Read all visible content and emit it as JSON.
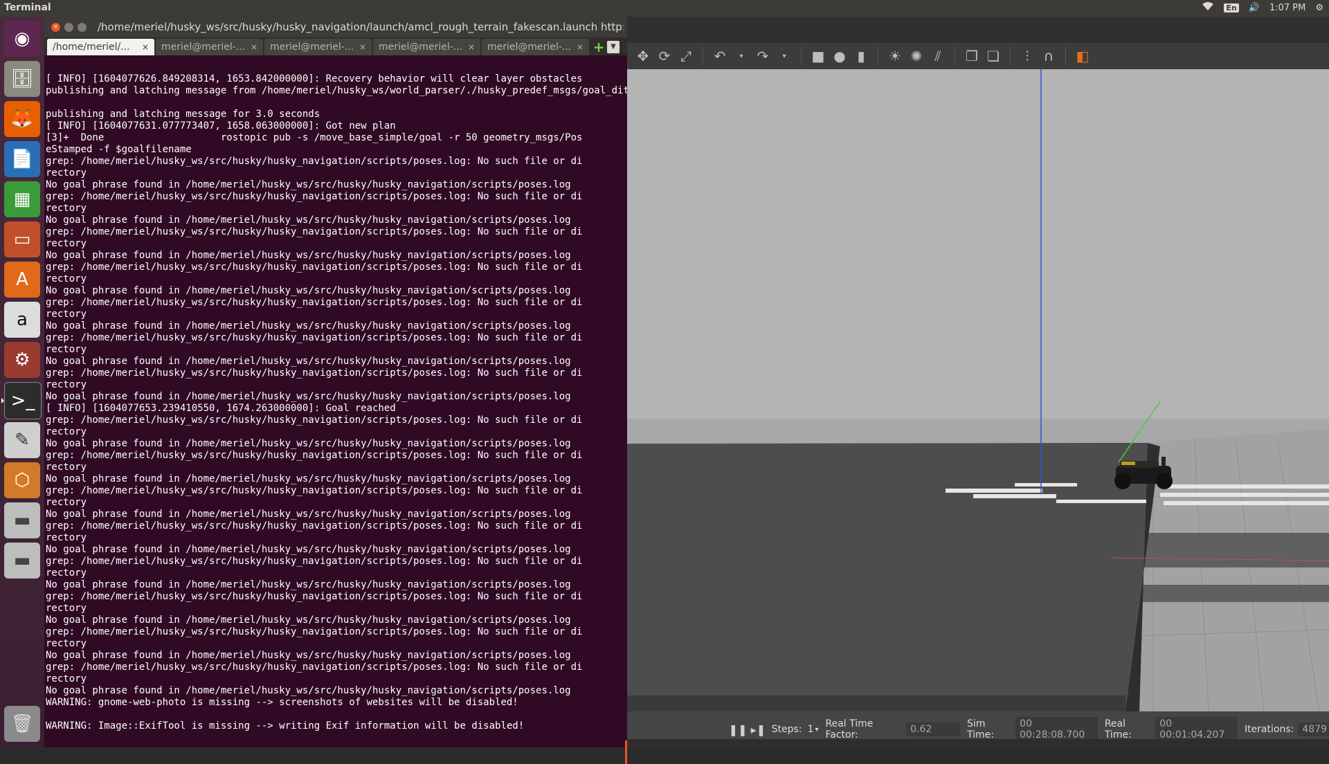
{
  "top_panel": {
    "app_title": "Terminal",
    "keyboard": "En",
    "time": "1:07 PM"
  },
  "launcher": {
    "items": [
      "ubuntu-dash",
      "files",
      "firefox",
      "writer",
      "calc",
      "impress",
      "software-center",
      "amazon",
      "system-settings",
      "terminal",
      "text-editor",
      "virtualbox",
      "drive-1",
      "drive-2",
      "trash"
    ]
  },
  "terminal": {
    "title": "/home/meriel/husky_ws/src/husky/husky_navigation/launch/amcl_rough_terrain_fakescan.launch http:/",
    "tabs": [
      {
        "label": "/home/meriel/..."
      },
      {
        "label": "meriel@meriel-..."
      },
      {
        "label": "meriel@meriel-..."
      },
      {
        "label": "meriel@meriel-..."
      },
      {
        "label": "meriel@meriel-..."
      }
    ],
    "lines": [
      "[ INFO] [1604077626.849208314, 1653.842000000]: Recovery behavior will clear layer obstacles",
      "publishing and latching message from /home/meriel/husky_ws/world_parser/./husky_predef_msgs/goal_ditch",
      "",
      "publishing and latching message for 3.0 seconds",
      "[ INFO] [1604077631.077773407, 1658.063000000]: Got new plan",
      "[3]+  Done                    rostopic pub -s /move_base_simple/goal -r 50 geometry_msgs/Pos",
      "eStamped -f $goalfilename",
      "grep: /home/meriel/husky_ws/src/husky/husky_navigation/scripts/poses.log: No such file or di",
      "rectory",
      "No goal phrase found in /home/meriel/husky_ws/src/husky/husky_navigation/scripts/poses.log",
      "grep: /home/meriel/husky_ws/src/husky/husky_navigation/scripts/poses.log: No such file or di",
      "rectory",
      "No goal phrase found in /home/meriel/husky_ws/src/husky/husky_navigation/scripts/poses.log",
      "grep: /home/meriel/husky_ws/src/husky/husky_navigation/scripts/poses.log: No such file or di",
      "rectory",
      "No goal phrase found in /home/meriel/husky_ws/src/husky/husky_navigation/scripts/poses.log",
      "grep: /home/meriel/husky_ws/src/husky/husky_navigation/scripts/poses.log: No such file or di",
      "rectory",
      "No goal phrase found in /home/meriel/husky_ws/src/husky/husky_navigation/scripts/poses.log",
      "grep: /home/meriel/husky_ws/src/husky/husky_navigation/scripts/poses.log: No such file or di",
      "rectory",
      "No goal phrase found in /home/meriel/husky_ws/src/husky/husky_navigation/scripts/poses.log",
      "grep: /home/meriel/husky_ws/src/husky/husky_navigation/scripts/poses.log: No such file or di",
      "rectory",
      "No goal phrase found in /home/meriel/husky_ws/src/husky/husky_navigation/scripts/poses.log",
      "grep: /home/meriel/husky_ws/src/husky/husky_navigation/scripts/poses.log: No such file or di",
      "rectory",
      "No goal phrase found in /home/meriel/husky_ws/src/husky/husky_navigation/scripts/poses.log",
      "[ INFO] [1604077653.239410550, 1674.263000000]: Goal reached",
      "grep: /home/meriel/husky_ws/src/husky/husky_navigation/scripts/poses.log: No such file or di",
      "rectory",
      "No goal phrase found in /home/meriel/husky_ws/src/husky/husky_navigation/scripts/poses.log",
      "grep: /home/meriel/husky_ws/src/husky/husky_navigation/scripts/poses.log: No such file or di",
      "rectory",
      "No goal phrase found in /home/meriel/husky_ws/src/husky/husky_navigation/scripts/poses.log",
      "grep: /home/meriel/husky_ws/src/husky/husky_navigation/scripts/poses.log: No such file or di",
      "rectory",
      "No goal phrase found in /home/meriel/husky_ws/src/husky/husky_navigation/scripts/poses.log",
      "grep: /home/meriel/husky_ws/src/husky/husky_navigation/scripts/poses.log: No such file or di",
      "rectory",
      "No goal phrase found in /home/meriel/husky_ws/src/husky/husky_navigation/scripts/poses.log",
      "grep: /home/meriel/husky_ws/src/husky/husky_navigation/scripts/poses.log: No such file or di",
      "rectory",
      "No goal phrase found in /home/meriel/husky_ws/src/husky/husky_navigation/scripts/poses.log",
      "grep: /home/meriel/husky_ws/src/husky/husky_navigation/scripts/poses.log: No such file or di",
      "rectory",
      "No goal phrase found in /home/meriel/husky_ws/src/husky/husky_navigation/scripts/poses.log",
      "grep: /home/meriel/husky_ws/src/husky/husky_navigation/scripts/poses.log: No such file or di",
      "rectory",
      "No goal phrase found in /home/meriel/husky_ws/src/husky/husky_navigation/scripts/poses.log",
      "grep: /home/meriel/husky_ws/src/husky/husky_navigation/scripts/poses.log: No such file or di",
      "rectory",
      "No goal phrase found in /home/meriel/husky_ws/src/husky/husky_navigation/scripts/poses.log",
      "WARNING: gnome-web-photo is missing --> screenshots of websites will be disabled!",
      "",
      "WARNING: Image::ExifTool is missing --> writing Exif information will be disabled!"
    ]
  },
  "gazebo": {
    "statusbar": {
      "steps_label": "Steps:",
      "steps_value": "1",
      "rtf_label": "Real Time Factor:",
      "rtf_value": "0.62",
      "sim_label": "Sim Time:",
      "sim_value": "00 00:28:08.700",
      "real_label": "Real Time:",
      "real_value": "00 00:01:04.207",
      "iter_label": "Iterations:",
      "iter_value": "4879"
    }
  }
}
